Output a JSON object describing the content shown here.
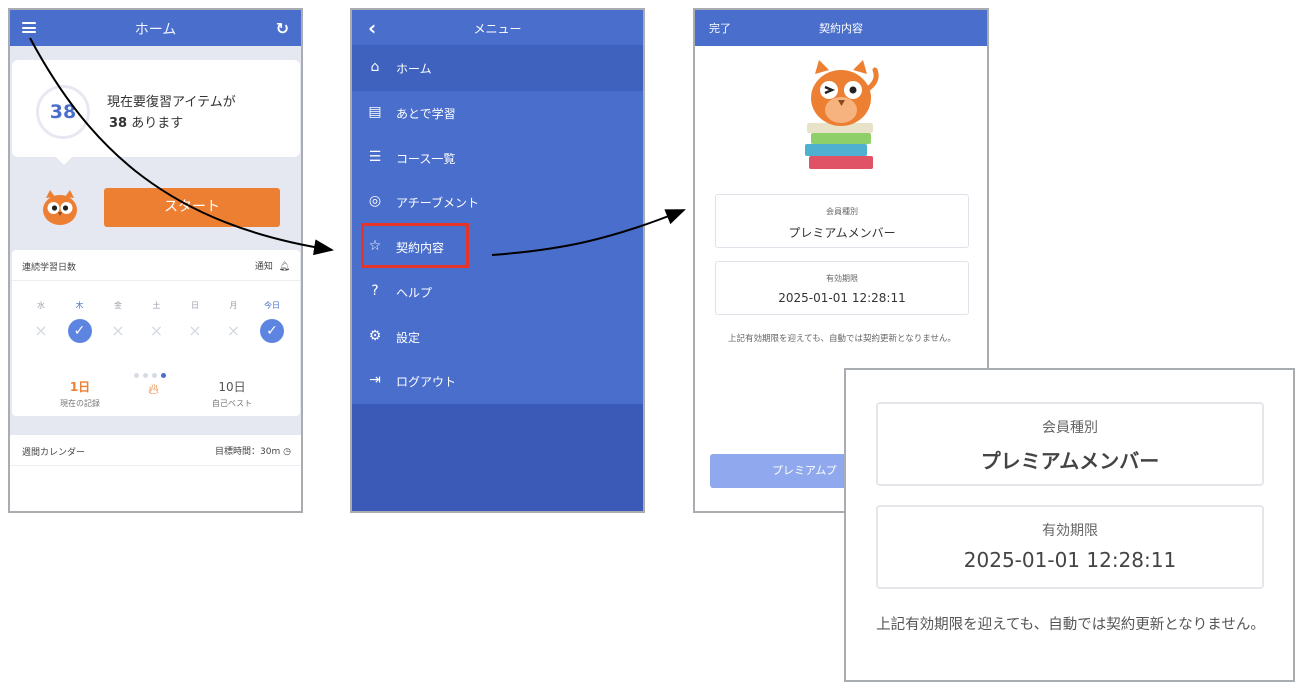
{
  "home": {
    "title": "ホーム",
    "due_count": "38",
    "due_line1": "現在要復習アイテムが",
    "due_line2_count": "38",
    "due_line2_suffix": "あります",
    "start_label": "スタート",
    "streak_title": "連続学習日数",
    "notify_label": "通知",
    "days": [
      {
        "label": "水",
        "done": false,
        "highlight": false
      },
      {
        "label": "木",
        "done": true,
        "highlight": true
      },
      {
        "label": "金",
        "done": false,
        "highlight": false
      },
      {
        "label": "土",
        "done": false,
        "highlight": false
      },
      {
        "label": "日",
        "done": false,
        "highlight": false
      },
      {
        "label": "月",
        "done": false,
        "highlight": false
      },
      {
        "label": "今日",
        "done": true,
        "highlight": true
      }
    ],
    "current_record": "1日",
    "current_record_label": "現在の記録",
    "best_record": "10日",
    "best_record_label": "自己ベスト",
    "week_calendar_title": "週間カレンダー",
    "goal_time": "目標時間：30m"
  },
  "menu": {
    "title": "メニュー",
    "items": [
      {
        "label": "ホーム",
        "icon": "home-icon",
        "glyph": "⌂"
      },
      {
        "label": "あとで学習",
        "icon": "library-icon",
        "glyph": "▤"
      },
      {
        "label": "コース一覧",
        "icon": "list-icon",
        "glyph": "☰"
      },
      {
        "label": "アチーブメント",
        "icon": "target-icon",
        "glyph": "◎"
      },
      {
        "label": "契約内容",
        "icon": "star-icon",
        "glyph": "☆"
      },
      {
        "label": "ヘルプ",
        "icon": "help-icon",
        "glyph": "?"
      },
      {
        "label": "設定",
        "icon": "gear-icon",
        "glyph": "⚙"
      },
      {
        "label": "ログアウト",
        "icon": "logout-icon",
        "glyph": "⇥"
      }
    ]
  },
  "contract": {
    "done_label": "完了",
    "title": "契約内容",
    "membership_key": "会員種別",
    "membership_value": "プレミアムメンバー",
    "expiry_key": "有効期限",
    "expiry_value": "2025-01-01 12:28:11",
    "note": "上記有効期限を迎えても、自動では契約更新となりません。",
    "premium_button": "プレミアムプ"
  },
  "colors": {
    "primary": "#4a6ecc",
    "accent": "#ed7f33",
    "highlight_box": "#e5342a"
  }
}
